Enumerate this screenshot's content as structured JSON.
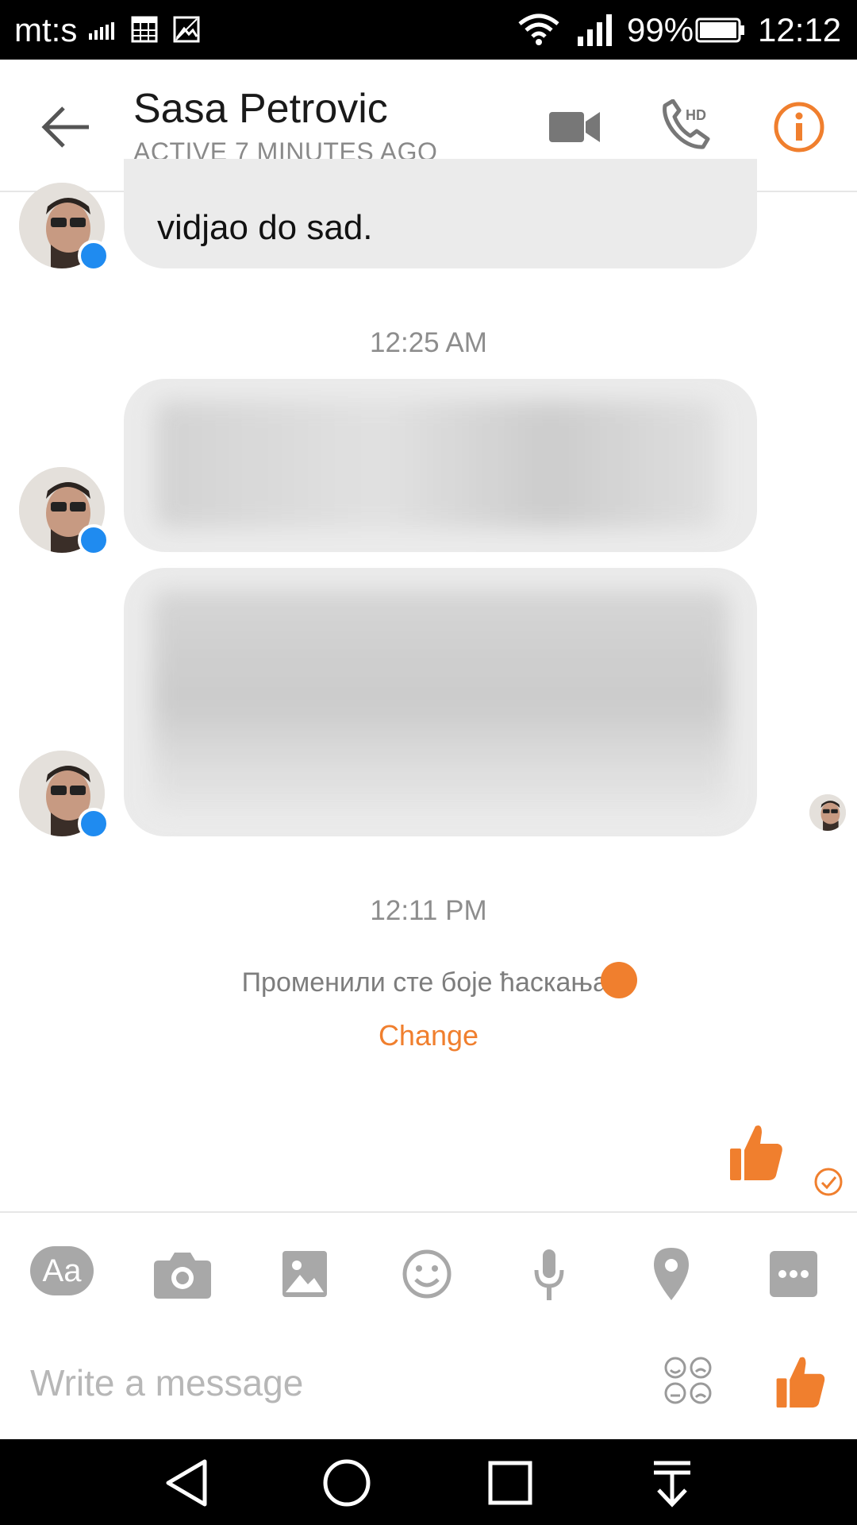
{
  "status_bar": {
    "carrier": "mt:s",
    "battery": "99%",
    "time": "12:12"
  },
  "header": {
    "contact_name": "Sasa Petrovic",
    "contact_status": "ACTIVE 7 MINUTES AGO"
  },
  "messages": {
    "partial_text": "vidjao do sad.",
    "timestamp_1": "12:25 AM",
    "timestamp_2": "12:11 PM",
    "system_notice": "Променили сте боје ћаскања.",
    "change_label": "Change"
  },
  "composer": {
    "placeholder": "Write a message",
    "aa_label": "Aa"
  },
  "colors": {
    "accent": "#f07f2e",
    "bubble": "#ebebeb",
    "messenger_badge": "#1f8bf0"
  }
}
